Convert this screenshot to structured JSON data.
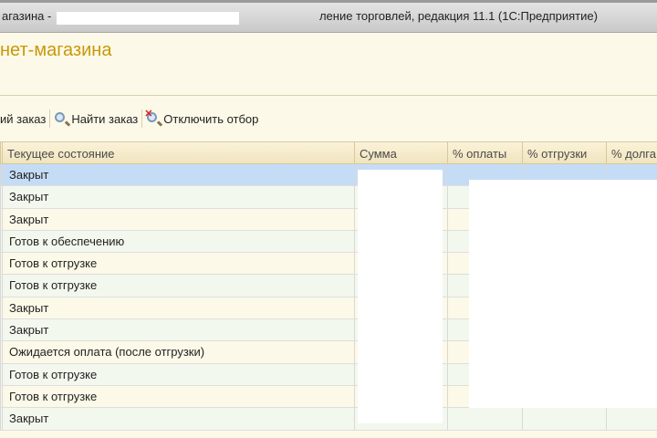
{
  "window": {
    "title_left": "агазина - ",
    "title_right": "ление торговлей, редакция 11.1  (1С:Предприятие)"
  },
  "form": {
    "title": "нет-магазина"
  },
  "toolbar": {
    "new_order": "ий заказ",
    "find_order": "Найти заказ",
    "disable_filter": "Отключить отбор"
  },
  "table": {
    "columns": [
      "Текущее состояние",
      "Сумма",
      "% оплаты",
      "% отгрузки",
      "% долга"
    ],
    "rows": [
      {
        "state": "Закрыт"
      },
      {
        "state": "Закрыт"
      },
      {
        "state": "Закрыт"
      },
      {
        "state": "Готов к обеспечению"
      },
      {
        "state": "Готов к отгрузке"
      },
      {
        "state": "Готов к отгрузке"
      },
      {
        "state": "Закрыт"
      },
      {
        "state": "Закрыт"
      },
      {
        "state": "Ожидается оплата (после отгрузки)"
      },
      {
        "state": "Готов к отгрузке"
      },
      {
        "state": "Готов к отгрузке"
      },
      {
        "state": "Закрыт"
      }
    ]
  }
}
